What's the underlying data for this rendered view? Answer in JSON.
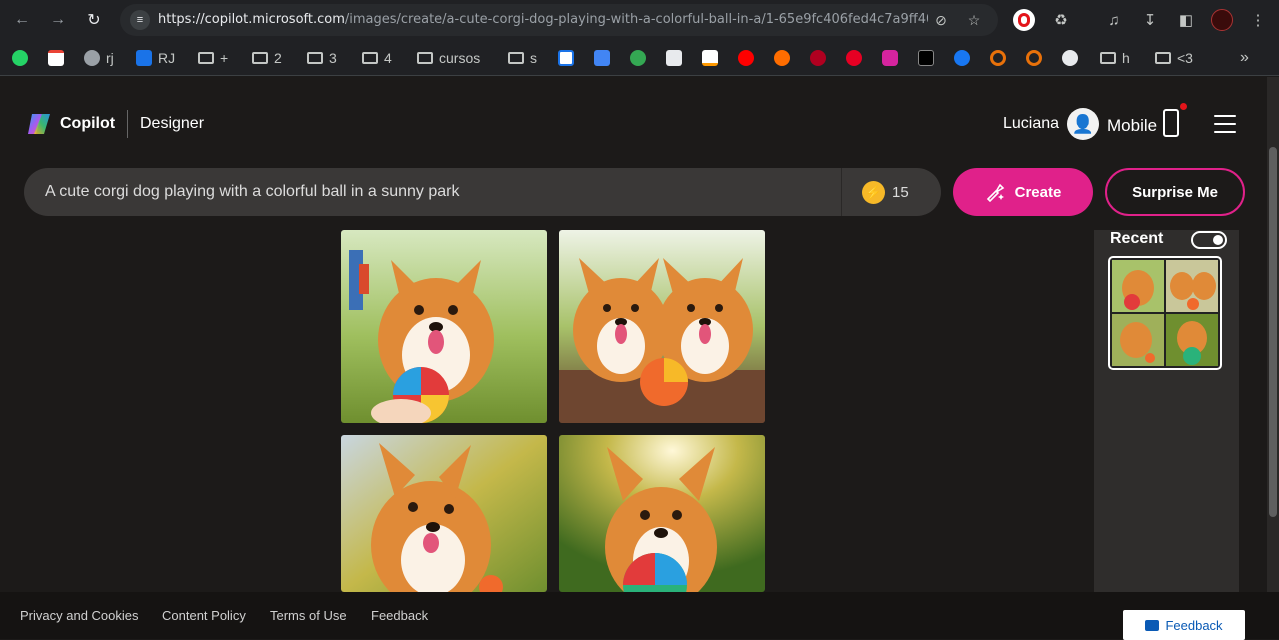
{
  "browser": {
    "url_host": "https://copilot.microsoft.com",
    "url_path": "/images/create/a-cute-corgi-dog-playing-with-a-colorful-ball-in-a/1-65e9fc406fed4c7a9ff40...",
    "bookmarks": [
      "rj",
      "RJ",
      "+",
      "2",
      "3",
      "4",
      "cursos",
      "s",
      "h",
      "<3"
    ],
    "icons": [
      "back-icon",
      "forward-icon",
      "reload-icon",
      "tune-icon",
      "eye-off-icon",
      "star-icon",
      "extension-icon",
      "download-icon",
      "sidebar-icon",
      "menu-icon"
    ]
  },
  "header": {
    "brand": "Copilot",
    "product": "Designer",
    "user_name": "Luciana",
    "mobile_label": "Mobile"
  },
  "prompt": {
    "text": "A cute corgi dog playing with a colorful ball in a sunny park",
    "boost_count": "15"
  },
  "buttons": {
    "create": "Create",
    "surprise": "Surprise Me"
  },
  "recent": {
    "title": "Recent"
  },
  "footer": {
    "links": [
      "Privacy and Cookies",
      "Content Policy",
      "Terms of Use",
      "Feedback"
    ],
    "feedback_button": "Feedback"
  },
  "colors": {
    "accent": "#e0218a",
    "background": "#1c1a19",
    "boost": "#f7b928"
  }
}
